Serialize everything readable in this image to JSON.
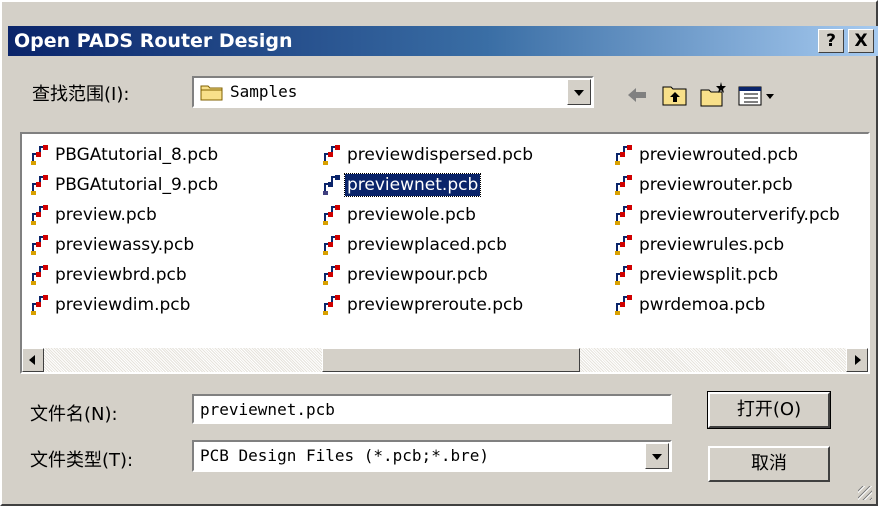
{
  "window": {
    "title": "Open PADS Router Design",
    "help_label": "?",
    "close_label": "X"
  },
  "lookin": {
    "label": "查找范围(I):",
    "value": "Samples"
  },
  "toolbar": {
    "back_icon": "back-arrow-icon",
    "up_icon": "up-folder-icon",
    "new_folder_icon": "new-folder-icon",
    "view_icon": "view-menu-icon"
  },
  "files": {
    "columns": [
      [
        "PBGAtutorial_8.pcb",
        "PBGAtutorial_9.pcb",
        "preview.pcb",
        "previewassy.pcb",
        "previewbrd.pcb",
        "previewdim.pcb"
      ],
      [
        "previewdispersed.pcb",
        "previewnet.pcb",
        "previewole.pcb",
        "previewplaced.pcb",
        "previewpour.pcb",
        "previewpreroute.pcb"
      ],
      [
        "previewrouted.pcb",
        "previewrouter.pcb",
        "previewrouterverify.pcb",
        "previewrules.pcb",
        "previewsplit.pcb",
        "pwrdemoa.pcb"
      ]
    ],
    "selected": "previewnet.pcb"
  },
  "filename": {
    "label": "文件名(N):",
    "value": "previewnet.pcb"
  },
  "filetype": {
    "label": "文件类型(T):",
    "value": "PCB Design Files (*.pcb;*.bre)"
  },
  "buttons": {
    "open": "打开(O)",
    "cancel": "取消"
  },
  "colors": {
    "title_start": "#0a246a",
    "title_end": "#a6caf0",
    "face": "#d4d0c8",
    "selection": "#0a246a"
  }
}
